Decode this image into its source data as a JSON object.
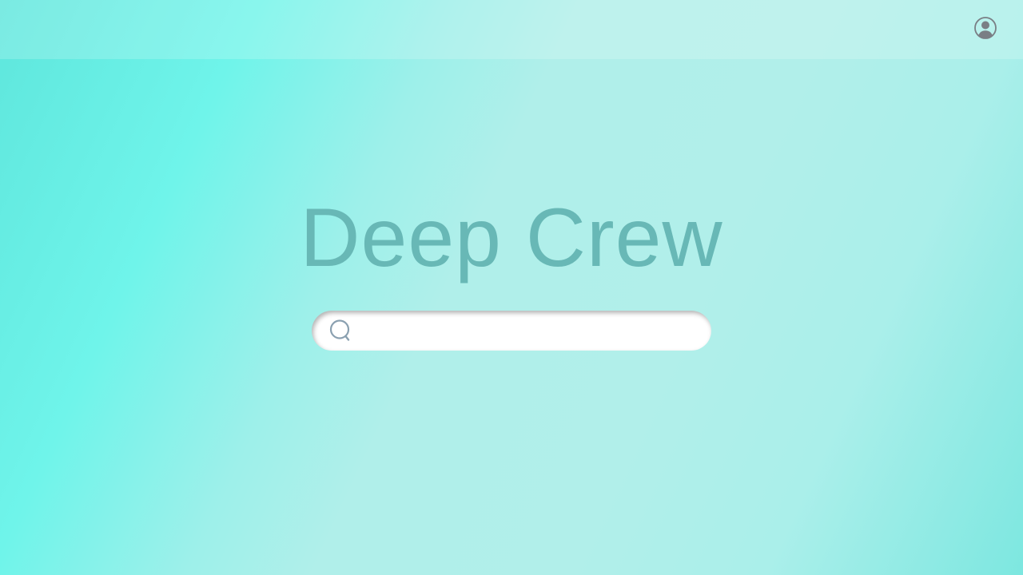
{
  "topbar": {
    "profile_icon": "account-circle-icon"
  },
  "brand": {
    "title": "Deep Crew"
  },
  "search": {
    "value": "",
    "placeholder": "",
    "icon": "search-icon"
  },
  "colors": {
    "brand_text": "#68b8b6",
    "icon_gray": "#7a7f85",
    "search_icon": "#8aa0b0"
  }
}
